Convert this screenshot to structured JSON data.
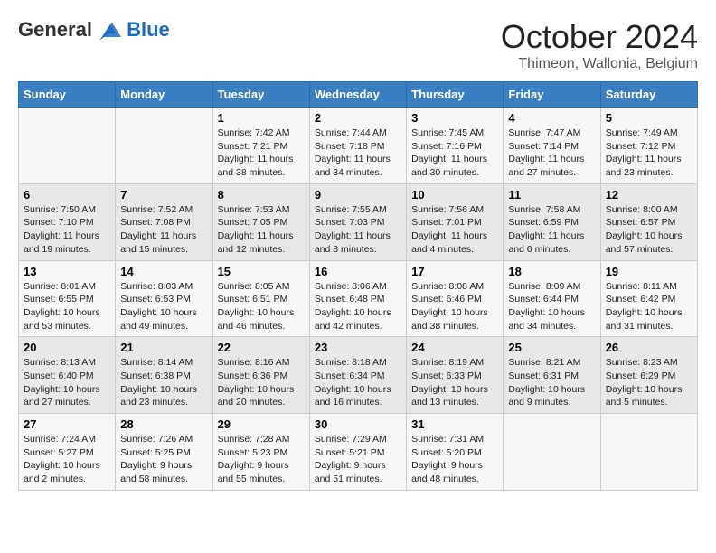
{
  "header": {
    "logo_line1": "General",
    "logo_line2": "Blue",
    "month": "October 2024",
    "location": "Thimeon, Wallonia, Belgium"
  },
  "days_of_week": [
    "Sunday",
    "Monday",
    "Tuesday",
    "Wednesday",
    "Thursday",
    "Friday",
    "Saturday"
  ],
  "weeks": [
    [
      {
        "day": "",
        "info": ""
      },
      {
        "day": "",
        "info": ""
      },
      {
        "day": "1",
        "info": "Sunrise: 7:42 AM\nSunset: 7:21 PM\nDaylight: 11 hours and 38 minutes."
      },
      {
        "day": "2",
        "info": "Sunrise: 7:44 AM\nSunset: 7:18 PM\nDaylight: 11 hours and 34 minutes."
      },
      {
        "day": "3",
        "info": "Sunrise: 7:45 AM\nSunset: 7:16 PM\nDaylight: 11 hours and 30 minutes."
      },
      {
        "day": "4",
        "info": "Sunrise: 7:47 AM\nSunset: 7:14 PM\nDaylight: 11 hours and 27 minutes."
      },
      {
        "day": "5",
        "info": "Sunrise: 7:49 AM\nSunset: 7:12 PM\nDaylight: 11 hours and 23 minutes."
      }
    ],
    [
      {
        "day": "6",
        "info": "Sunrise: 7:50 AM\nSunset: 7:10 PM\nDaylight: 11 hours and 19 minutes."
      },
      {
        "day": "7",
        "info": "Sunrise: 7:52 AM\nSunset: 7:08 PM\nDaylight: 11 hours and 15 minutes."
      },
      {
        "day": "8",
        "info": "Sunrise: 7:53 AM\nSunset: 7:05 PM\nDaylight: 11 hours and 12 minutes."
      },
      {
        "day": "9",
        "info": "Sunrise: 7:55 AM\nSunset: 7:03 PM\nDaylight: 11 hours and 8 minutes."
      },
      {
        "day": "10",
        "info": "Sunrise: 7:56 AM\nSunset: 7:01 PM\nDaylight: 11 hours and 4 minutes."
      },
      {
        "day": "11",
        "info": "Sunrise: 7:58 AM\nSunset: 6:59 PM\nDaylight: 11 hours and 0 minutes."
      },
      {
        "day": "12",
        "info": "Sunrise: 8:00 AM\nSunset: 6:57 PM\nDaylight: 10 hours and 57 minutes."
      }
    ],
    [
      {
        "day": "13",
        "info": "Sunrise: 8:01 AM\nSunset: 6:55 PM\nDaylight: 10 hours and 53 minutes."
      },
      {
        "day": "14",
        "info": "Sunrise: 8:03 AM\nSunset: 6:53 PM\nDaylight: 10 hours and 49 minutes."
      },
      {
        "day": "15",
        "info": "Sunrise: 8:05 AM\nSunset: 6:51 PM\nDaylight: 10 hours and 46 minutes."
      },
      {
        "day": "16",
        "info": "Sunrise: 8:06 AM\nSunset: 6:48 PM\nDaylight: 10 hours and 42 minutes."
      },
      {
        "day": "17",
        "info": "Sunrise: 8:08 AM\nSunset: 6:46 PM\nDaylight: 10 hours and 38 minutes."
      },
      {
        "day": "18",
        "info": "Sunrise: 8:09 AM\nSunset: 6:44 PM\nDaylight: 10 hours and 34 minutes."
      },
      {
        "day": "19",
        "info": "Sunrise: 8:11 AM\nSunset: 6:42 PM\nDaylight: 10 hours and 31 minutes."
      }
    ],
    [
      {
        "day": "20",
        "info": "Sunrise: 8:13 AM\nSunset: 6:40 PM\nDaylight: 10 hours and 27 minutes."
      },
      {
        "day": "21",
        "info": "Sunrise: 8:14 AM\nSunset: 6:38 PM\nDaylight: 10 hours and 23 minutes."
      },
      {
        "day": "22",
        "info": "Sunrise: 8:16 AM\nSunset: 6:36 PM\nDaylight: 10 hours and 20 minutes."
      },
      {
        "day": "23",
        "info": "Sunrise: 8:18 AM\nSunset: 6:34 PM\nDaylight: 10 hours and 16 minutes."
      },
      {
        "day": "24",
        "info": "Sunrise: 8:19 AM\nSunset: 6:33 PM\nDaylight: 10 hours and 13 minutes."
      },
      {
        "day": "25",
        "info": "Sunrise: 8:21 AM\nSunset: 6:31 PM\nDaylight: 10 hours and 9 minutes."
      },
      {
        "day": "26",
        "info": "Sunrise: 8:23 AM\nSunset: 6:29 PM\nDaylight: 10 hours and 5 minutes."
      }
    ],
    [
      {
        "day": "27",
        "info": "Sunrise: 7:24 AM\nSunset: 5:27 PM\nDaylight: 10 hours and 2 minutes."
      },
      {
        "day": "28",
        "info": "Sunrise: 7:26 AM\nSunset: 5:25 PM\nDaylight: 9 hours and 58 minutes."
      },
      {
        "day": "29",
        "info": "Sunrise: 7:28 AM\nSunset: 5:23 PM\nDaylight: 9 hours and 55 minutes."
      },
      {
        "day": "30",
        "info": "Sunrise: 7:29 AM\nSunset: 5:21 PM\nDaylight: 9 hours and 51 minutes."
      },
      {
        "day": "31",
        "info": "Sunrise: 7:31 AM\nSunset: 5:20 PM\nDaylight: 9 hours and 48 minutes."
      },
      {
        "day": "",
        "info": ""
      },
      {
        "day": "",
        "info": ""
      }
    ]
  ]
}
